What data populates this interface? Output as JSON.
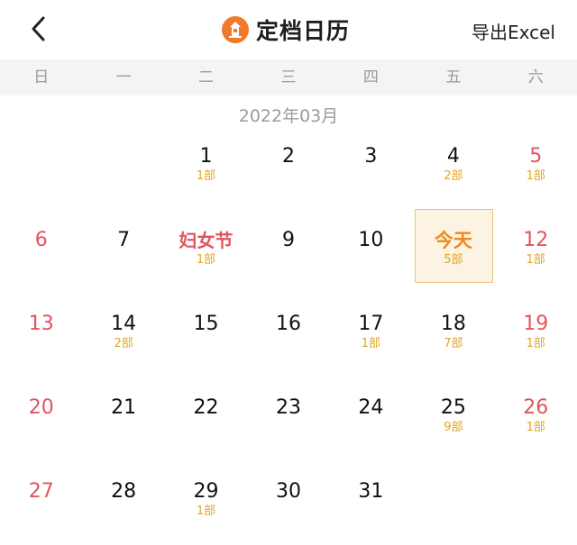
{
  "header": {
    "back_icon": "chevron-left-icon",
    "logo_icon": "lighthouse-icon",
    "title": "定档日历",
    "export_label": "导出Excel"
  },
  "colors": {
    "weekend": "#e2545e",
    "today": "#ee8a1e",
    "count": "#e3a51c",
    "today_bg": "#fdf3e2",
    "logo": "#f07a2b"
  },
  "weekdays": [
    "日",
    "一",
    "二",
    "三",
    "四",
    "五",
    "六"
  ],
  "month_label": "2022年03月",
  "days": [
    {
      "label": "1",
      "count": "1部"
    },
    {
      "label": "2",
      "count": ""
    },
    {
      "label": "3",
      "count": ""
    },
    {
      "label": "4",
      "count": "2部"
    },
    {
      "label": "5",
      "count": "1部"
    },
    {
      "label": "6",
      "count": ""
    },
    {
      "label": "7",
      "count": ""
    },
    {
      "label": "妇女节",
      "count": "1部"
    },
    {
      "label": "9",
      "count": ""
    },
    {
      "label": "10",
      "count": ""
    },
    {
      "label": "今天",
      "count": "5部"
    },
    {
      "label": "12",
      "count": "1部"
    },
    {
      "label": "13",
      "count": ""
    },
    {
      "label": "14",
      "count": "2部"
    },
    {
      "label": "15",
      "count": ""
    },
    {
      "label": "16",
      "count": ""
    },
    {
      "label": "17",
      "count": "1部"
    },
    {
      "label": "18",
      "count": "7部"
    },
    {
      "label": "19",
      "count": "1部"
    },
    {
      "label": "20",
      "count": ""
    },
    {
      "label": "21",
      "count": ""
    },
    {
      "label": "22",
      "count": ""
    },
    {
      "label": "23",
      "count": ""
    },
    {
      "label": "24",
      "count": ""
    },
    {
      "label": "25",
      "count": "9部"
    },
    {
      "label": "26",
      "count": "1部"
    },
    {
      "label": "27",
      "count": ""
    },
    {
      "label": "28",
      "count": ""
    },
    {
      "label": "29",
      "count": "1部"
    },
    {
      "label": "30",
      "count": ""
    },
    {
      "label": "31",
      "count": ""
    }
  ]
}
